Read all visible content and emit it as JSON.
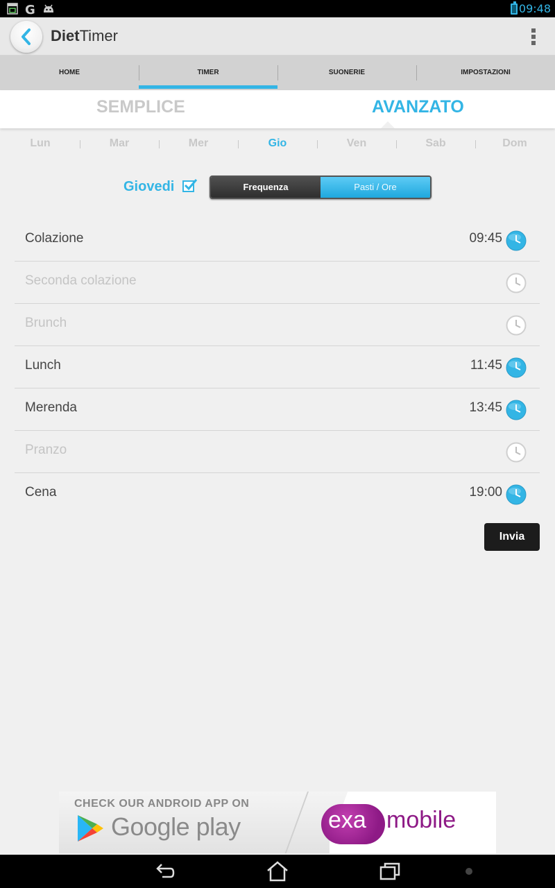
{
  "status_bar": {
    "time": "09:48"
  },
  "action_bar": {
    "title_bold": "Diet",
    "title_rest": "Timer"
  },
  "main_tabs": [
    {
      "label": "HOME",
      "active": false
    },
    {
      "label": "TIMER",
      "active": true
    },
    {
      "label": "SUONERIE",
      "active": false
    },
    {
      "label": "IMPOSTAZIONI",
      "active": false
    }
  ],
  "modes": {
    "simple": "SEMPLICE",
    "advanced": "AVANZATO",
    "selected": "advanced"
  },
  "days": [
    {
      "label": "Lun",
      "active": false
    },
    {
      "label": "Mar",
      "active": false
    },
    {
      "label": "Mer",
      "active": false
    },
    {
      "label": "Gio",
      "active": true
    },
    {
      "label": "Ven",
      "active": false
    },
    {
      "label": "Sab",
      "active": false
    },
    {
      "label": "Dom",
      "active": false
    }
  ],
  "day_row": {
    "name": "Giovedi",
    "checked": true,
    "segments": {
      "left": "Frequenza",
      "right": "Pasti / Ore",
      "selected": "right"
    }
  },
  "meals": [
    {
      "name": "Colazione",
      "time": "09:45",
      "enabled": true
    },
    {
      "name": "Seconda colazione",
      "time": "",
      "enabled": false
    },
    {
      "name": "Brunch",
      "time": "",
      "enabled": false
    },
    {
      "name": "Lunch",
      "time": "11:45",
      "enabled": true
    },
    {
      "name": "Merenda",
      "time": "13:45",
      "enabled": true
    },
    {
      "name": "Pranzo",
      "time": "",
      "enabled": false
    },
    {
      "name": "Cena",
      "time": "19:00",
      "enabled": true
    }
  ],
  "submit_label": "Invia",
  "ad": {
    "line1": "CHECK OUR ANDROID APP ON",
    "store": "Google play",
    "brand_exa": "exa",
    "brand_mobile": "mobile"
  },
  "colors": {
    "accent": "#33b5e5",
    "brand": "#8e1a86",
    "dark_button": "#1c1c1c"
  }
}
